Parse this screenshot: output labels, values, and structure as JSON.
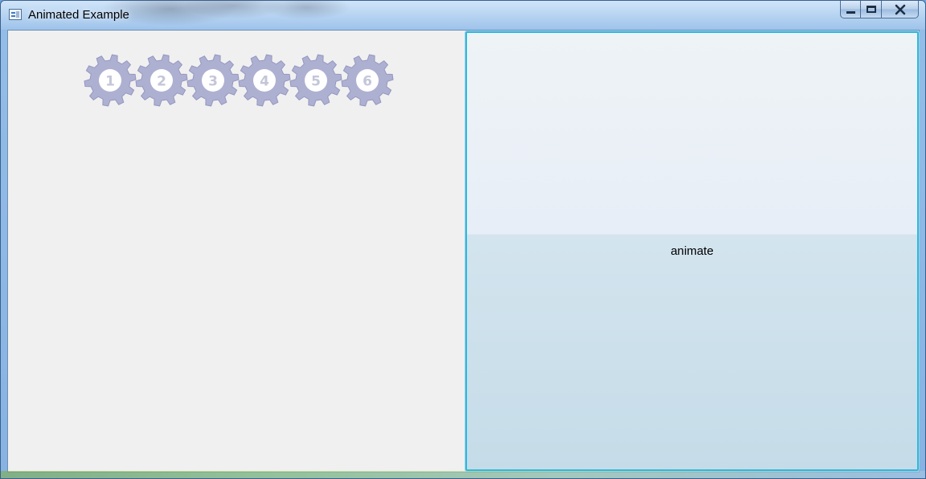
{
  "window": {
    "title": "Animated Example",
    "controls": {
      "minimize": "minimize",
      "maximize": "maximize",
      "close": "close"
    }
  },
  "gears": [
    {
      "label": "1"
    },
    {
      "label": "2"
    },
    {
      "label": "3"
    },
    {
      "label": "4"
    },
    {
      "label": "5"
    },
    {
      "label": "6"
    }
  ],
  "button": {
    "label": "animate"
  },
  "colors": {
    "gear_fill": "#aeb0d2",
    "gear_stroke": "#9497c0",
    "gear_center": "#ffffff",
    "gear_text": "#c4c6d8",
    "button_border": "#2fb8dc"
  },
  "icons": {
    "app": "window-app-icon",
    "minimize": "minimize-icon",
    "maximize": "maximize-icon",
    "close": "close-icon",
    "gear": "gear-icon"
  }
}
